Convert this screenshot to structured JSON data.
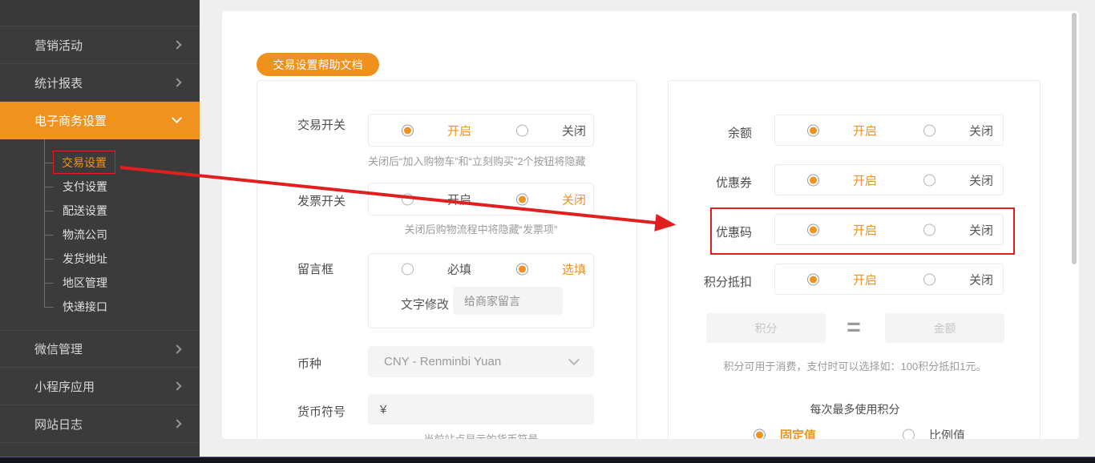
{
  "sidebar": {
    "items": [
      {
        "label": "营销活动"
      },
      {
        "label": "统计报表"
      },
      {
        "label": "电子商务设置"
      },
      {
        "label": "微信管理"
      },
      {
        "label": "小程序应用"
      },
      {
        "label": "网站日志"
      }
    ],
    "submenu": [
      {
        "label": "交易设置"
      },
      {
        "label": "支付设置"
      },
      {
        "label": "配送设置"
      },
      {
        "label": "物流公司"
      },
      {
        "label": "发货地址"
      },
      {
        "label": "地区管理"
      },
      {
        "label": "快递接口"
      }
    ]
  },
  "toolbar": {
    "help_button_label": "交易设置帮助文档"
  },
  "left_panel": {
    "trade_switch": {
      "label": "交易开关",
      "on_label": "开启",
      "off_label": "关闭",
      "selected": "on",
      "help": "关闭后“加入购物车”和“立刻购买”2个按钮将隐藏"
    },
    "invoice_switch": {
      "label": "发票开关",
      "on_label": "开启",
      "off_label": "关闭",
      "selected": "off",
      "help": "关闭后购物流程中将隐藏“发票项”"
    },
    "message_box": {
      "label": "留言框",
      "required_label": "必填",
      "optional_label": "选填",
      "selected": "optional",
      "text_edit_label": "文字修改",
      "text_value": "给商家留言"
    },
    "currency": {
      "label": "币种",
      "value": "CNY - Renminbi Yuan"
    },
    "currency_symbol": {
      "label": "货币符号",
      "value": "¥",
      "help": "当前站点显示的货币符号"
    }
  },
  "right_panel": {
    "balance": {
      "label": "余额",
      "on_label": "开启",
      "off_label": "关闭",
      "selected": "on"
    },
    "coupon": {
      "label": "优惠券",
      "on_label": "开启",
      "off_label": "关闭",
      "selected": "on"
    },
    "promo_code": {
      "label": "优惠码",
      "on_label": "开启",
      "off_label": "关闭",
      "selected": "on"
    },
    "points_deduction": {
      "label": "积分抵扣",
      "on_label": "开启",
      "off_label": "关闭",
      "selected": "on"
    },
    "points_rate": {
      "points_placeholder": "积分",
      "equals": "=",
      "amount_placeholder": "金额"
    },
    "points_help": "积分可用于消费，支付时可以选择如：100积分抵扣1元。",
    "max_points_label": "每次最多使用积分",
    "value_type": {
      "fixed_label": "固定值",
      "ratio_label": "比例值",
      "selected": "fixed"
    }
  },
  "colors": {
    "accent": "#f0921f",
    "annotation_red": "#e02020",
    "sidebar_bg": "#3b3b3b"
  }
}
